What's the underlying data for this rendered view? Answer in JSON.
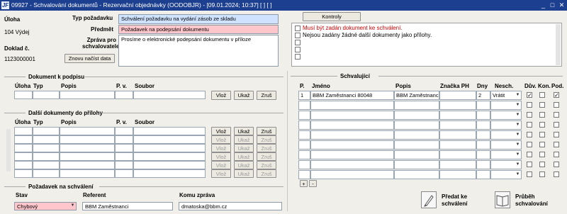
{
  "window": {
    "title": "09927 - Schvalování dokumentů - Rezervační objednávky (OODOBJR) - [09.01.2024; 10:37] [ ] [ ]",
    "app_icon": "JF",
    "controls": [
      "_",
      "□",
      "✕"
    ]
  },
  "left": {
    "uloha_label": "Úloha",
    "uloha_value": "104 Výdej",
    "doklad_label": "Doklad č.",
    "doklad_value": "1123000001",
    "reload_button": "Znovu načíst data"
  },
  "request": {
    "typ_label": "Typ požadavku",
    "typ_value": "Schválení požadavku na vydání zásob ze skladu",
    "predmet_label": "Předmět",
    "predmet_value": "Požadavek na podepsání dokumentu",
    "zprava_label": "Zpráva pro schvalovatele",
    "zprava_value": "Prosíme o elektronické podepsání dokumentu v příloze"
  },
  "controls_panel": {
    "title": "Kontroly",
    "items": [
      {
        "text": "Musí být zadán dokument ke schválení.",
        "color": "#d40000"
      },
      {
        "text": "Nejsou zadány žádné další dokumenty jako přílohy.",
        "color": "#000000"
      },
      {
        "text": ""
      },
      {
        "text": ""
      },
      {
        "text": ""
      }
    ]
  },
  "doc_sign": {
    "title": "Dokument k podpisu",
    "columns": [
      "Úloha",
      "Typ",
      "Popis",
      "P. v.",
      "Soubor"
    ],
    "buttons": [
      "Vlož",
      "Ukaž",
      "Zruš"
    ]
  },
  "attachments": {
    "title": "Další dokumenty do přílohy",
    "columns": [
      "Úloha",
      "Typ",
      "Popis",
      "P. v.",
      "Soubor"
    ],
    "buttons": [
      "Vlož",
      "Ukaž",
      "Zruš"
    ]
  },
  "approval": {
    "title": "Požadavek na schválení",
    "stav_label": "Stav",
    "stav_value": "Chybový",
    "referent_label": "Referent",
    "referent_value": "BBM Zaměstnanci",
    "komu_label": "Komu zpráva",
    "komu_value": "dmatoska@bbm.cz"
  },
  "approvers": {
    "title": "Schvalující",
    "columns": [
      "P.",
      "Jméno",
      "Popis",
      "Značka PH",
      "Dny",
      "Nesch.",
      "Dův.",
      "Kon.",
      "Pod."
    ],
    "rows": [
      {
        "p": "1",
        "jmeno": "BBM Zaměstnanci 80048",
        "popis": "BBM Zaměstnanc",
        "znacka": "",
        "dny": "2",
        "nesch": "Vrátit",
        "duv": true,
        "kon": false,
        "pod": true
      }
    ],
    "add_button": "+",
    "remove_button": "-"
  },
  "actions": {
    "predat": "Předat ke schválení",
    "prubeh": "Průběh schvalování"
  },
  "colors": {
    "titlebar": "#1d3f8f",
    "required_field": "#ffc7cc",
    "highlight_field": "#cfe2ff",
    "error_text": "#d40000"
  }
}
